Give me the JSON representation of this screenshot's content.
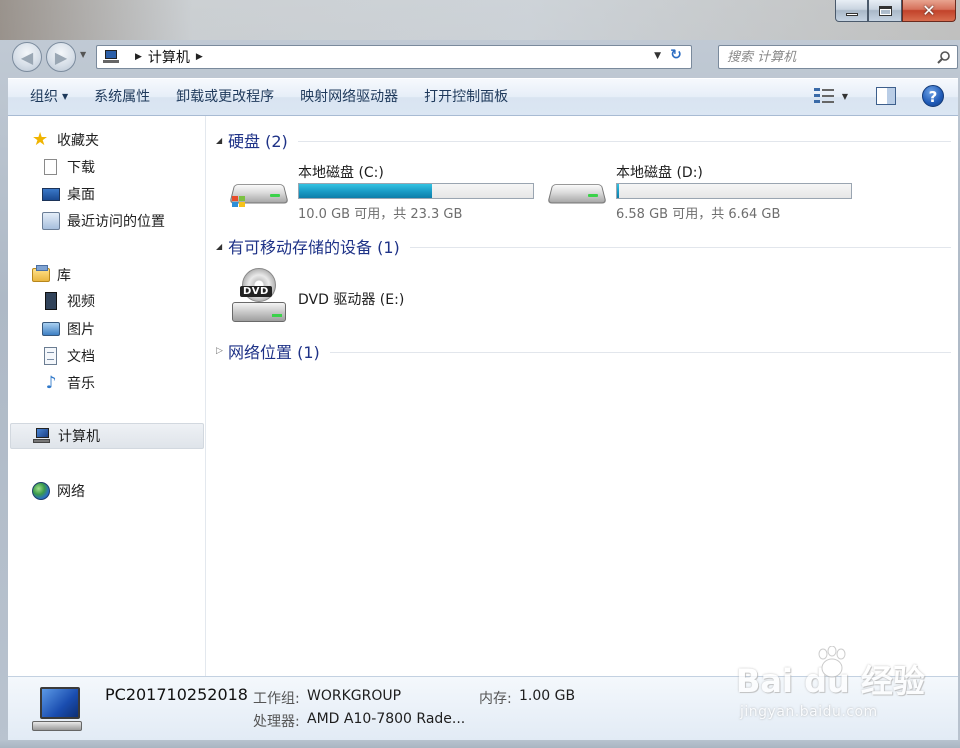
{
  "window": {
    "caption": {
      "minimize": "minimize",
      "maximize": "maximize",
      "close": "close"
    }
  },
  "address_bar": {
    "segments": [
      "计算机"
    ],
    "current": "计算机"
  },
  "search": {
    "placeholder": "搜索 计算机"
  },
  "toolbar": {
    "organize": "组织",
    "items": [
      "系统属性",
      "卸载或更改程序",
      "映射网络驱动器",
      "打开控制面板"
    ]
  },
  "sidebar": {
    "favorites": {
      "label": "收藏夹",
      "items": [
        "下载",
        "桌面",
        "最近访问的位置"
      ]
    },
    "libraries": {
      "label": "库",
      "items": [
        "视频",
        "图片",
        "文档",
        "音乐"
      ]
    },
    "computer": {
      "label": "计算机"
    },
    "network": {
      "label": "网络"
    }
  },
  "groups": {
    "hdd": {
      "title": "硬盘 (2)"
    },
    "removable": {
      "title": "有可移动存储的设备 (1)"
    },
    "network": {
      "title": "网络位置 (1)"
    }
  },
  "drives": [
    {
      "label": "本地磁盘 (C:)",
      "free": "10.0 GB 可用，共 23.3 GB",
      "used_fraction": 0.57
    },
    {
      "label": "本地磁盘 (D:)",
      "free": "6.58 GB 可用，共 6.64 GB",
      "used_fraction": 0.01
    }
  ],
  "dvd": {
    "badge": "DVD",
    "label": "DVD 驱动器 (E:)"
  },
  "details": {
    "name": "PC201710252018",
    "workgroup_label": "工作组:",
    "workgroup": "WORKGROUP",
    "memory_label": "内存:",
    "memory": "1.00 GB",
    "cpu_label": "处理器:",
    "cpu": "AMD A10-7800 Rade..."
  },
  "watermark": {
    "brand": "Bai du 经验",
    "sub": "jingyan.baidu.com"
  },
  "colors": {
    "accent": "#1e3287",
    "bar_fill": "#1b9dc7",
    "toolbar_text": "#1e395b"
  }
}
